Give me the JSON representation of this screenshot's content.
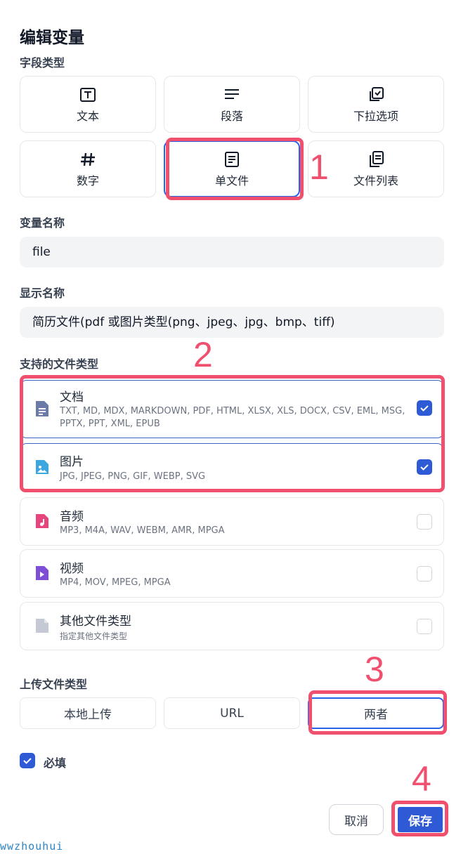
{
  "dialog": {
    "title": "编辑变量"
  },
  "field_type": {
    "label": "字段类型",
    "options": [
      {
        "label": "文本",
        "icon": "text-icon"
      },
      {
        "label": "段落",
        "icon": "paragraph-icon"
      },
      {
        "label": "下拉选项",
        "icon": "select-icon"
      },
      {
        "label": "数字",
        "icon": "hash-icon"
      },
      {
        "label": "单文件",
        "icon": "file-icon"
      },
      {
        "label": "文件列表",
        "icon": "file-list-icon"
      }
    ],
    "selected": "单文件"
  },
  "variable_name": {
    "label": "变量名称",
    "value": "file"
  },
  "display_name": {
    "label": "显示名称",
    "value": "简历文件(pdf 或图片类型(png、jpeg、jpg、bmp、tiff)"
  },
  "file_types": {
    "label": "支持的文件类型",
    "items": [
      {
        "name": "文档",
        "desc": "TXT, MD, MDX, MARKDOWN, PDF, HTML, XLSX, XLS, DOCX, CSV, EML, MSG, PPTX, PPT, XML, EPUB",
        "checked": true,
        "color": "#6b7ba8"
      },
      {
        "name": "图片",
        "desc": "JPG, JPEG, PNG, GIF, WEBP, SVG",
        "checked": true,
        "color": "#3ba7e0"
      },
      {
        "name": "音频",
        "desc": "MP3, M4A, WAV, WEBM, AMR, MPGA",
        "checked": false,
        "color": "#e8457f"
      },
      {
        "name": "视频",
        "desc": "MP4, MOV, MPEG, MPGA",
        "checked": false,
        "color": "#7e4fd6"
      },
      {
        "name": "其他文件类型",
        "desc": "指定其他文件类型",
        "checked": false,
        "color": "#c5c9d6"
      }
    ]
  },
  "upload_type": {
    "label": "上传文件类型",
    "options": [
      "本地上传",
      "URL",
      "两者"
    ],
    "selected": "两者"
  },
  "required": {
    "label": "必填",
    "checked": true
  },
  "actions": {
    "cancel": "取消",
    "save": "保存"
  },
  "annotations": [
    "1",
    "2",
    "3",
    "4"
  ],
  "watermark": "wwzhouhui",
  "colors": {
    "accent": "#2f5ad6",
    "annotation": "#f0506e"
  }
}
